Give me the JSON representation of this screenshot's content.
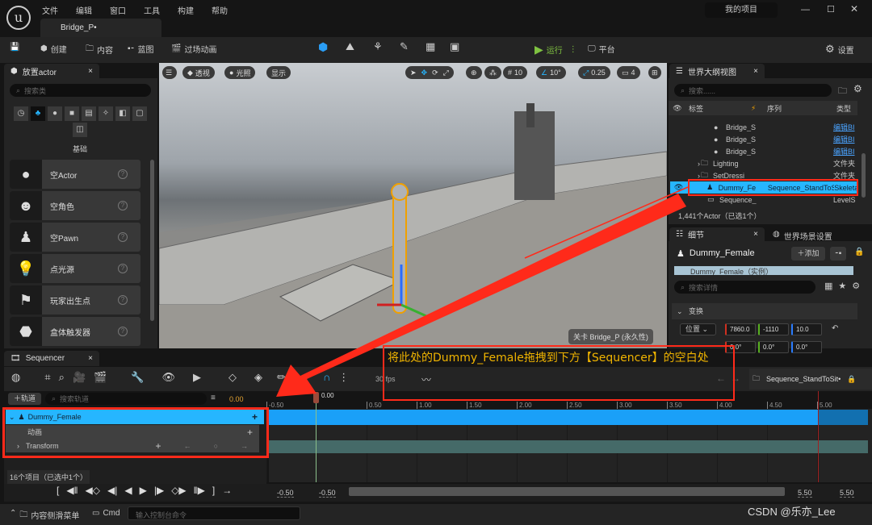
{
  "menu": [
    "文件",
    "编辑",
    "窗口",
    "工具",
    "构建",
    "帮助"
  ],
  "project": "我的项目",
  "level_tab": "Bridge_P•",
  "toolbar": {
    "create": "创建",
    "content": "内容",
    "blueprint": "蓝图",
    "cinematics": "过场动画",
    "play": "运行",
    "platform": "平台",
    "settings": "设置"
  },
  "place_actor": {
    "title": "放置actor",
    "search_placeholder": "搜索类",
    "category": "基础",
    "items": [
      {
        "label": "空Actor",
        "icon": "sphere-icon"
      },
      {
        "label": "空角色",
        "icon": "character-icon"
      },
      {
        "label": "空Pawn",
        "icon": "pawn-icon"
      },
      {
        "label": "点光源",
        "icon": "light-bulb-icon"
      },
      {
        "label": "玩家出生点",
        "icon": "player-start-icon"
      },
      {
        "label": "盒体触发器",
        "icon": "box-trigger-icon"
      }
    ]
  },
  "viewport": {
    "perspective": "透视",
    "lighting": "光照",
    "show": "显示",
    "grid": "10",
    "angle": "10°",
    "scale": "0.25",
    "camera": "4",
    "level_label": "关卡  Bridge_P (永久性)"
  },
  "outliner": {
    "title": "世界大纲视图",
    "search_placeholder": "搜索......",
    "cols": [
      "标签",
      "序列",
      "类型"
    ],
    "rows": [
      {
        "label": "Bridge_S",
        "type": "编辑BI"
      },
      {
        "label": "Bridge_S",
        "type": "编辑BI"
      },
      {
        "label": "Bridge_S",
        "type": "编辑BI"
      },
      {
        "label": "Lighting",
        "type": "文件夹"
      },
      {
        "label": "SetDressi",
        "type": "文件夹"
      },
      {
        "label": "Dummy_Fe",
        "seq": "Sequence_StandToS",
        "type": "Skeleta"
      },
      {
        "label": "Sequence_",
        "type": "LevelS"
      }
    ],
    "count": "1,441个Actor（已选1个）"
  },
  "details": {
    "title": "细节",
    "world_settings": "世界场景设置",
    "actor": "Dummy_Female",
    "add": "添加",
    "instance": "Dummy_Female（实例）",
    "search_placeholder": "搜索详情",
    "section": "变换",
    "location_label": "位置",
    "loc": [
      "7860.0",
      "-1110",
      "10.0"
    ],
    "rot": [
      "0.0°",
      "0.0°",
      "0.0°"
    ]
  },
  "sequencer": {
    "title": "Sequencer",
    "add_track": "轨道",
    "search_placeholder": "搜索轨道",
    "time": "0.00",
    "fps": "30 fps",
    "sequence": "Sequence_StandToSit•",
    "playhead": "0.00",
    "ticks": [
      "-0.50",
      "0.50",
      "1.00",
      "1.50",
      "2.00",
      "2.50",
      "3.00",
      "3.50",
      "4.00",
      "4.50",
      "5.00"
    ],
    "tracks": {
      "actor": "Dummy_Female",
      "anim": "动画",
      "transform": "Transform"
    },
    "count": "16个项目（已选中1个）",
    "range": [
      "-0.50",
      "-0.50",
      "5.50",
      "5.50"
    ]
  },
  "status": {
    "content_drawer": "内容侧滑菜单",
    "cmd": "Cmd",
    "console_placeholder": "输入控制台命令"
  },
  "annotation": "将此处的Dummy_Female拖拽到下方【Sequencer】的空白处",
  "watermark": "CSDN @乐亦_Lee",
  "colors": {
    "accent": "#26b6ff",
    "annotation": "#ff2a1a",
    "annotation_text": "#f0b400"
  }
}
